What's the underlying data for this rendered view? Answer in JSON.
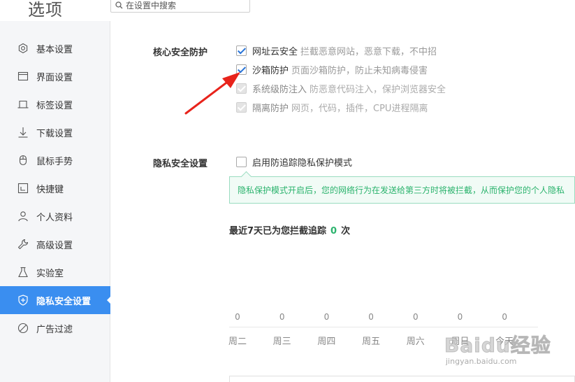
{
  "window": {
    "title": "选项"
  },
  "search": {
    "placeholder": "在设置中搜索"
  },
  "sidebar": {
    "items": [
      {
        "label": "基本设置",
        "icon": "gear-icon"
      },
      {
        "label": "界面设置",
        "icon": "window-icon"
      },
      {
        "label": "标签设置",
        "icon": "tab-icon"
      },
      {
        "label": "下载设置",
        "icon": "download-icon"
      },
      {
        "label": "鼠标手势",
        "icon": "mouse-icon"
      },
      {
        "label": "快捷键",
        "icon": "shortcut-icon"
      },
      {
        "label": "个人资料",
        "icon": "user-icon"
      },
      {
        "label": "高级设置",
        "icon": "wrench-icon"
      },
      {
        "label": "实验室",
        "icon": "flask-icon"
      },
      {
        "label": "隐私安全设置",
        "icon": "shield-icon",
        "active": true
      },
      {
        "label": "广告过滤",
        "icon": "block-icon"
      }
    ]
  },
  "core": {
    "title": "核心安全防护",
    "options": [
      {
        "label": "网址云安全",
        "desc": "拦截恶意网站，恶意下载，不中招",
        "checked": true,
        "disabled": false
      },
      {
        "label": "沙箱防护",
        "desc": "页面沙箱防护，防止未知病毒侵害",
        "checked": true,
        "disabled": false
      },
      {
        "label": "系统级防注入",
        "desc": "防恶意代码注入，保护浏览器安全",
        "checked": true,
        "disabled": true
      },
      {
        "label": "隔离防护",
        "desc": "网页，代码，插件，CPU进程隔离",
        "checked": true,
        "disabled": true
      }
    ]
  },
  "privacy": {
    "title": "隐私安全设置",
    "option_label": "启用防追踪隐私保护模式",
    "option_checked": false,
    "notice": "隐私保护模式开启后，您的网络行为在发送给第三方时将被拦截，从而保护您的个人隐私",
    "stats_prefix": "最近7天已为您拦截追踪",
    "stats_count": "0",
    "stats_suffix": "次"
  },
  "chart_data": {
    "type": "bar",
    "categories": [
      "周二",
      "周三",
      "周四",
      "周五",
      "周六",
      "周日",
      "今天"
    ],
    "values": [
      0,
      0,
      0,
      0,
      0,
      0,
      0
    ]
  },
  "watermark": {
    "text": "Baidu经验",
    "url": "jingyan.baidu.com"
  },
  "colors": {
    "accent": "#3a8ef0",
    "success": "#2bb36d",
    "arrow": "#e8231b"
  }
}
